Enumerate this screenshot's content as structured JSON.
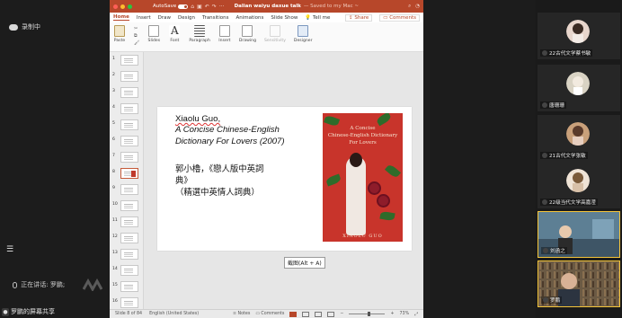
{
  "meeting": {
    "recording_label": "录制中",
    "speaking_label": "正在讲话: 罗鹏;",
    "screen_share_caption": "罗鹏的屏幕共享"
  },
  "ppt": {
    "autosave_label": "AutoSave",
    "autosave_state": "OFF",
    "doc_title": "Dalian waiyu daxue talk",
    "doc_saved": "— Saved to my Mac ~",
    "menu": [
      "Home",
      "Insert",
      "Draw",
      "Design",
      "Transitions",
      "Animations",
      "Slide Show",
      "Tell me"
    ],
    "share_label": "Share",
    "comments_label": "Comments",
    "ribbon": {
      "paste": "Paste",
      "slides": "Slides",
      "font": "Font",
      "paragraph": "Paragraph",
      "insert": "Insert",
      "drawing": "Drawing",
      "sensitivity": "Sensitivity",
      "designer": "Designer"
    },
    "thumbnails": [
      "1",
      "2",
      "3",
      "4",
      "5",
      "6",
      "7",
      "8",
      "9",
      "10",
      "11",
      "12",
      "13",
      "14",
      "15",
      "16"
    ],
    "selected_thumbnail": "8",
    "slide": {
      "line1": "Xiaolu Guo,",
      "line2": "A Concise Chinese-English",
      "line3": "Dictionary For Lovers (2007)",
      "line4": "郭小櫓，《戀人版中英詞",
      "line5": "典》",
      "line6": "（精選中英情人詞典）"
    },
    "book_cover": {
      "title_line1": "A Concise",
      "title_line2": "Chinese-English Dictionary",
      "title_line3": "For Lovers",
      "author": "XIAOLU GUO"
    },
    "tooltip": "截图(Alt + A)",
    "status": {
      "slide_of": "Slide 8 of 84",
      "language": "English (United States)",
      "notes": "Notes",
      "comments": "Comments",
      "zoom": "73%"
    }
  },
  "gallery": [
    {
      "name": "22古代文学蔡书敏",
      "avatar_color": "#e8d6cc"
    },
    {
      "name": "唐珊珊",
      "avatar_color": "#d9d3c4"
    },
    {
      "name": "21古代文学张敏",
      "avatar_color": "#c9a07a"
    },
    {
      "name": "22级当代文学高嘉滢",
      "avatar_color": "#efe3d6"
    },
    {
      "name": "刘函之",
      "avatar_color": "#4a6f8a"
    },
    {
      "name": "罗鹏",
      "avatar_color": "#6b5a44"
    }
  ]
}
